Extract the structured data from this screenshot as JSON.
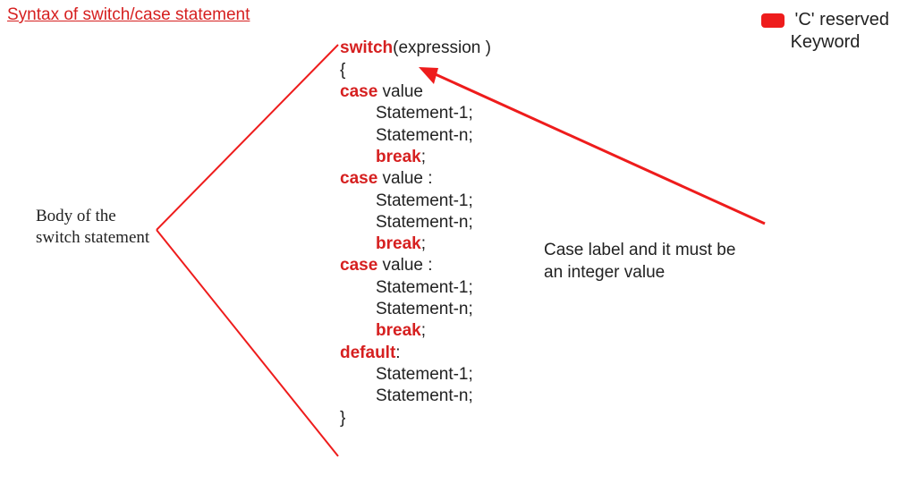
{
  "title": "Syntax of switch/case statement",
  "left_label_line1": "Body of the",
  "left_label_line2": "switch statement",
  "right_label_line1": "Case label and it must be",
  "right_label_line2": "an integer value",
  "legend_line1": "'C' reserved",
  "legend_line2": "Keyword",
  "code": {
    "kw_switch": "switch",
    "expr": "(expression )",
    "brace_open": "{",
    "kw_case": "case",
    "value_no_colon": " value",
    "value_colon": " value :",
    "stmt1": "Statement-1;",
    "stmtn": "Statement-n;",
    "kw_break": "break",
    "semicolon": ";",
    "kw_default": "default",
    "colon": ":",
    "brace_close": "}"
  },
  "colors": {
    "keyword": "#d62020",
    "arrow": "#ee1c1c",
    "text": "#222222"
  }
}
